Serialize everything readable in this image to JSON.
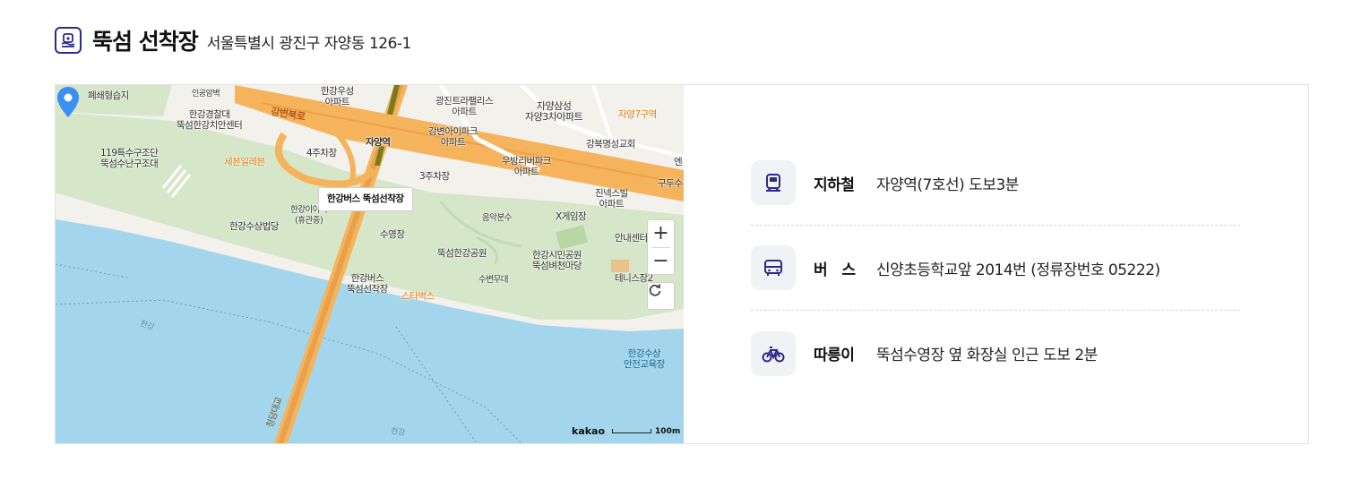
{
  "header": {
    "icon": "ferry-icon",
    "title": "뚝섬 선착장",
    "address": "서울특별시 광진구 자양동 126-1"
  },
  "map": {
    "callout": "한강버스 뚝섬선착장",
    "zoom_in": "+",
    "zoom_out": "−",
    "attribution": "kakao",
    "scale_label": "100m",
    "labels": {
      "l1": "폐쇄형습지",
      "l2": "인공암벽",
      "l3": "한강우성\n아파트",
      "l4": "광진트라팰리스\n아파트",
      "l5": "자양삼성\n자양3차아파트",
      "l6": "자양7구역",
      "l7": "한강경찰대\n뚝섬한강치안센터",
      "l8": "강변북로",
      "l9": "강변아이파크\n아파트",
      "l10": "강북명성교회",
      "l11": "119특수구조단\n뚝섬수난구조대",
      "l12": "세븐일레븐",
      "l13": "4주차장",
      "l14": "자양역",
      "l15": "우방리버파크\n아파트",
      "l16": "엔",
      "l17": "3주차장",
      "l18": "구두수",
      "l19": "진넥스빌\n아파트",
      "l20": "한강수상법당",
      "l21": "한강이야기\n(휴관중)",
      "l22": "수영장",
      "l23": "음악분수",
      "l24": "X게임장",
      "l25": "안내센터",
      "l26": "뚝섬한강공원",
      "l27": "한강시민공원\n뚝섬벼천마당",
      "l28": "한강버스\n뚝섬선착장",
      "l29": "스타벅스",
      "l30": "수변무대",
      "l31": "테니스장2",
      "l32": "한강",
      "l33": "한강수상\n안전교육장",
      "l34": "한강",
      "l35": "청담대교"
    }
  },
  "transport": [
    {
      "icon": "subway-icon",
      "label": "지하철",
      "value": "자양역(7호선) 도보3분"
    },
    {
      "icon": "bus-icon",
      "label": "버   스",
      "value": "신양초등학교앞 2014번 (정류장번호 05222)"
    },
    {
      "icon": "bike-icon",
      "label": "따릉이",
      "value": "뚝섬수영장 옆 화장실 인근 도보 2분"
    }
  ],
  "colors": {
    "accent": "#2e2a8c",
    "river": "#a3d6ec",
    "park": "#d5e7c8",
    "road": "#f5b35c",
    "rail": "#7a7a1a",
    "pin": "#3a8ff2"
  }
}
